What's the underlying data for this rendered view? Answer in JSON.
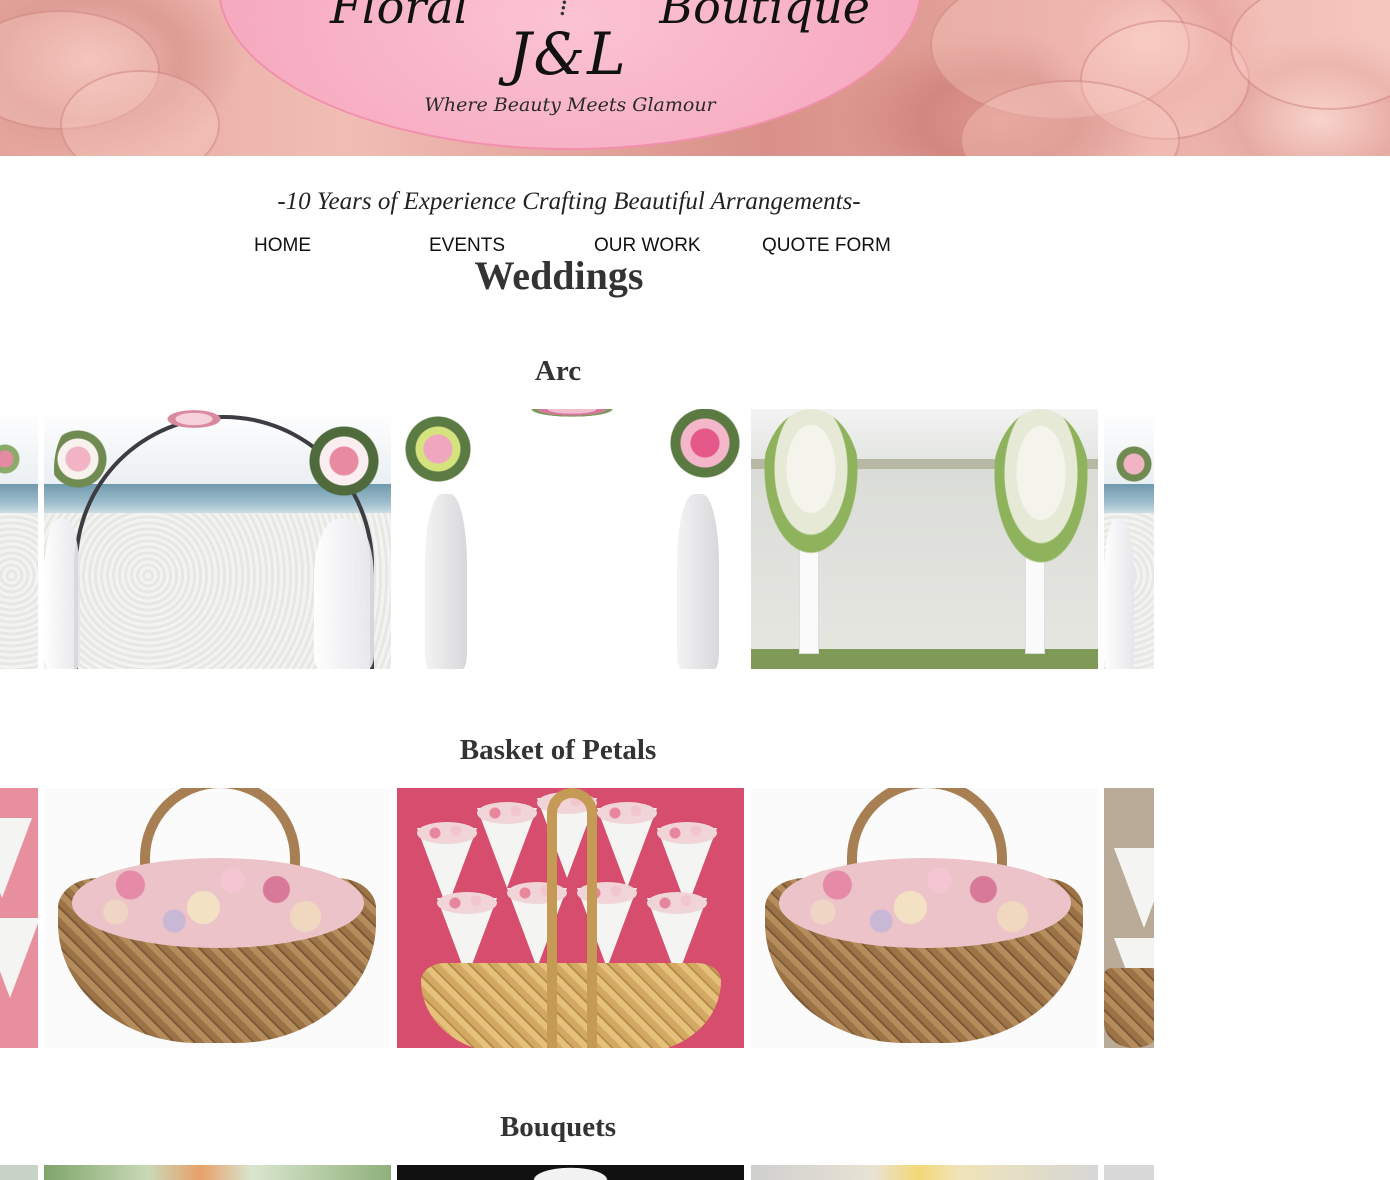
{
  "brand": {
    "line1_left": "Floral",
    "line1_right": "Boutique",
    "monogram": "J&L",
    "tagline": "Where Beauty Meets Glamour"
  },
  "experience_text": "-10 Years of Experience Crafting Beautiful Arrangements-",
  "nav": {
    "items": [
      {
        "label": "HOME"
      },
      {
        "label": "EVENTS"
      },
      {
        "label": "OUR WORK"
      },
      {
        "label": "QUOTE FORM"
      }
    ]
  },
  "page_title": "Weddings",
  "sections": [
    {
      "title": "Arc"
    },
    {
      "title": "Basket of Petals"
    },
    {
      "title": "Bouquets"
    }
  ],
  "colors": {
    "banner_rose": "#e5a59c",
    "oval_pink": "#f6a9bf",
    "text_dark": "#333333"
  }
}
